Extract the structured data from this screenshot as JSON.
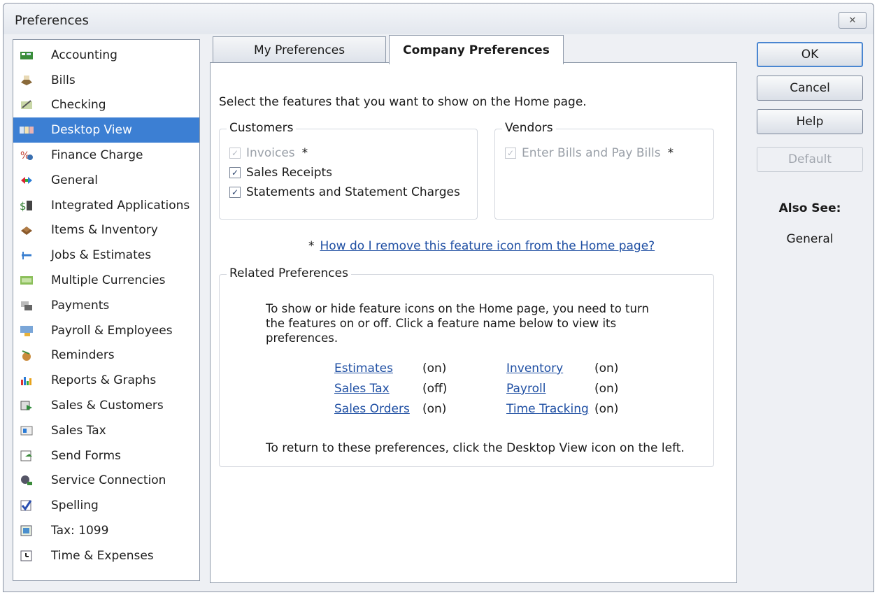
{
  "window": {
    "title": "Preferences",
    "close_label": "✕"
  },
  "categories": [
    {
      "label": "Accounting",
      "icon": "accounting-icon"
    },
    {
      "label": "Bills",
      "icon": "bills-icon"
    },
    {
      "label": "Checking",
      "icon": "checking-icon"
    },
    {
      "label": "Desktop View",
      "icon": "desktop-view-icon",
      "selected": true
    },
    {
      "label": "Finance Charge",
      "icon": "finance-charge-icon"
    },
    {
      "label": "General",
      "icon": "general-icon"
    },
    {
      "label": "Integrated Applications",
      "icon": "integrated-applications-icon"
    },
    {
      "label": "Items & Inventory",
      "icon": "items-inventory-icon"
    },
    {
      "label": "Jobs & Estimates",
      "icon": "jobs-estimates-icon"
    },
    {
      "label": "Multiple Currencies",
      "icon": "multiple-currencies-icon"
    },
    {
      "label": "Payments",
      "icon": "payments-icon"
    },
    {
      "label": "Payroll & Employees",
      "icon": "payroll-employees-icon"
    },
    {
      "label": "Reminders",
      "icon": "reminders-icon"
    },
    {
      "label": "Reports & Graphs",
      "icon": "reports-graphs-icon"
    },
    {
      "label": "Sales & Customers",
      "icon": "sales-customers-icon"
    },
    {
      "label": "Sales Tax",
      "icon": "sales-tax-icon"
    },
    {
      "label": "Send Forms",
      "icon": "send-forms-icon"
    },
    {
      "label": "Service Connection",
      "icon": "service-connection-icon"
    },
    {
      "label": "Spelling",
      "icon": "spelling-icon"
    },
    {
      "label": "Tax: 1099",
      "icon": "tax-1099-icon"
    },
    {
      "label": "Time & Expenses",
      "icon": "time-expenses-icon"
    }
  ],
  "tabs": {
    "my_preferences": "My Preferences",
    "company_preferences": "Company Preferences",
    "active": "company_preferences"
  },
  "content": {
    "intro": "Select the features that you want to show on the Home page.",
    "customers": {
      "title": "Customers",
      "items": [
        {
          "label": "Invoices",
          "checked": true,
          "disabled": true,
          "asterisk": "*"
        },
        {
          "label": "Sales Receipts",
          "checked": true,
          "disabled": false
        },
        {
          "label": "Statements and Statement Charges",
          "checked": true,
          "disabled": false
        }
      ]
    },
    "vendors": {
      "title": "Vendors",
      "items": [
        {
          "label": "Enter Bills and Pay Bills",
          "checked": true,
          "disabled": true,
          "asterisk": "*"
        }
      ]
    },
    "help_asterisk": "*",
    "help_link": "How do I remove this feature icon from the Home page?",
    "related": {
      "title": "Related Preferences",
      "description": "To show or hide feature icons on the Home page, you need to turn the features on or off. Click a feature name below to view its preferences.",
      "items": [
        {
          "label": "Estimates",
          "status": "(on)"
        },
        {
          "label": "Sales Tax",
          "status": "(off)"
        },
        {
          "label": "Sales Orders",
          "status": "(on)"
        },
        {
          "label": "Inventory",
          "status": "(on)"
        },
        {
          "label": "Payroll",
          "status": "(on)"
        },
        {
          "label": "Time Tracking",
          "status": "(on)"
        }
      ],
      "footer": "To return to these preferences, click the Desktop View icon on the left."
    }
  },
  "buttons": {
    "ok": "OK",
    "cancel": "Cancel",
    "help": "Help",
    "default": "Default"
  },
  "also_see": {
    "title": "Also See:",
    "items": [
      "General"
    ]
  },
  "colors": {
    "selection": "#3c7fd3",
    "link": "#1f4fa3",
    "accent_border": "#4a86d1"
  }
}
